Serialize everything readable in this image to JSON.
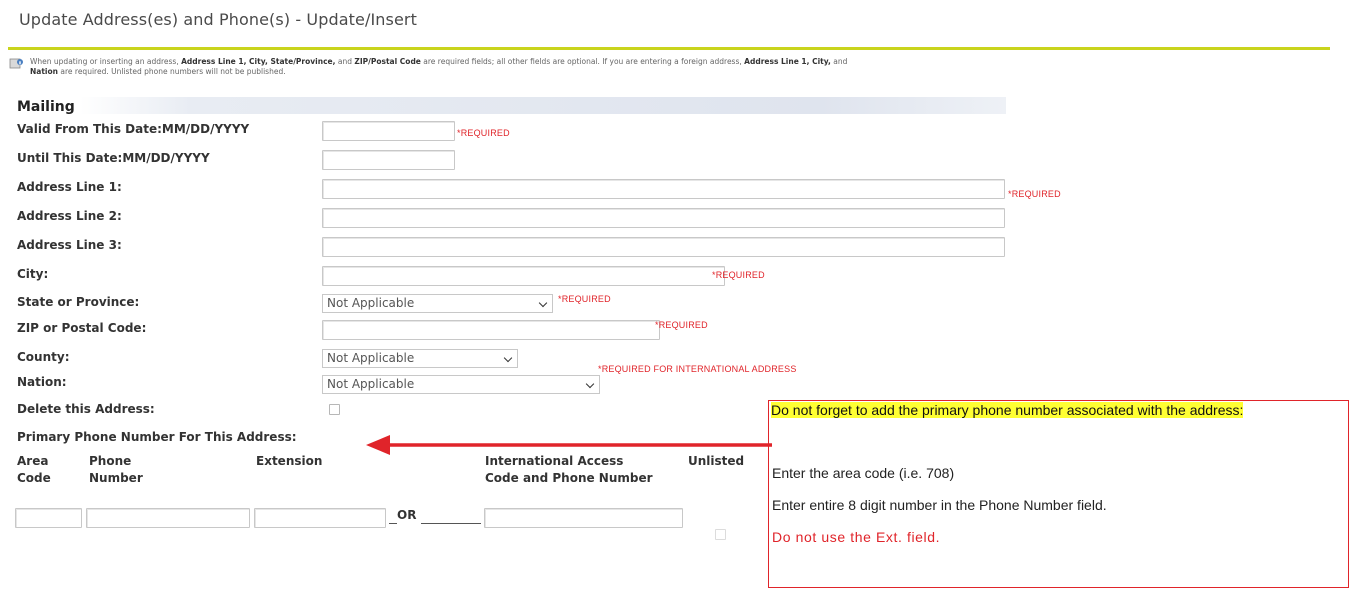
{
  "page": {
    "title": "Update Address(es) and Phone(s) - Update/Insert"
  },
  "info": {
    "icon": "info-icon",
    "part1": "When updating or inserting an address,",
    "bold1": "Address Line 1, City, State/Province,",
    "part2": "and",
    "bold2": "ZIP/Postal Code",
    "part3": "are required fields; all other fields are optional. If you are entering a foreign address,",
    "bold3": "Address Line 1, City,",
    "part4": "and",
    "bold4": "Nation",
    "part5": "are required. Unlisted phone numbers will not be published."
  },
  "section": {
    "title": "Mailing"
  },
  "form": {
    "valid_from_label": "Valid From This Date:MM/DD/YYYY",
    "until_label": "Until This Date:MM/DD/YYYY",
    "address1_label": "Address Line 1:",
    "address2_label": "Address Line 2:",
    "address3_label": "Address Line 3:",
    "city_label": "City:",
    "state_label": "State or Province:",
    "zip_label": "ZIP or Postal Code:",
    "county_label": "County:",
    "nation_label": "Nation:",
    "delete_label": "Delete this Address:",
    "primary_phone_label": "Primary Phone Number For This Address:",
    "state_value": "Not Applicable",
    "county_value": "Not Applicable",
    "nation_value": "Not Applicable",
    "required": "*REQUIRED",
    "required_intl": "*REQUIRED FOR INTERNATIONAL ADDRESS"
  },
  "phone": {
    "col_area": "Area Code",
    "col_phone": "Phone Number",
    "col_ext": "Extension",
    "col_intl": "International Access Code and Phone Number",
    "col_unlisted": "Unlisted",
    "or_label": "OR"
  },
  "note": {
    "highlight": "Do not forget to add the primary phone number associated with the address:",
    "line1": "Enter the area code (i.e. 708)",
    "line2": "Enter entire 8 digit number in the Phone Number field.",
    "line3": "Do not use the Ext. field.",
    "arrow_color": "#e0242a",
    "highlight_color": "#ffff33"
  }
}
